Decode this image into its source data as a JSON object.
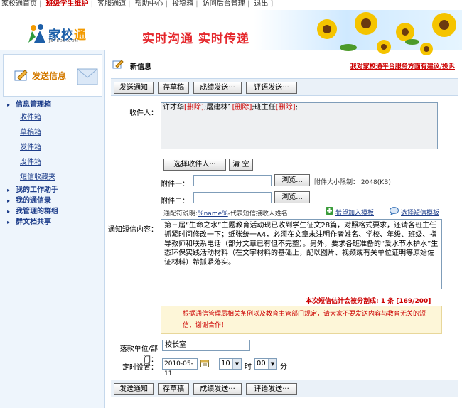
{
  "topnav": {
    "items": [
      "家校通首页",
      "班级学生维护",
      "客服通道",
      "帮助中心",
      "投稿箱",
      "访问后台管理",
      "退出"
    ],
    "active_index": 1
  },
  "banner": {
    "logo_name_a": "家校",
    "logo_name_b": "通",
    "logo_domain": "JSTEDU.COM",
    "slogan": "实时沟通 实时传递"
  },
  "sidebar": {
    "send_title": "发送信息",
    "groups": [
      {
        "label": "信息管理箱",
        "items": [
          "收件箱",
          "草稿箱",
          "发件箱",
          "废件箱",
          "短信收藏夹"
        ]
      },
      {
        "label": "我的工作助手",
        "items": []
      },
      {
        "label": "我的通信录",
        "items": []
      },
      {
        "label": "我管理的群组",
        "items": []
      },
      {
        "label": "群文档共享",
        "items": []
      }
    ]
  },
  "page": {
    "title": "新信息",
    "feedback_link": "我对家校通平台服务方面有建议/投诉"
  },
  "toolbar": {
    "send_notice": "发送通知",
    "save_draft": "存草稿",
    "send_grades": "成绩发送···",
    "send_comments": "评语发送···"
  },
  "form": {
    "recipient_label": "收件人：",
    "recipients": [
      {
        "name": "许才华",
        "action": "[删除]"
      },
      {
        "name": "屠建林1",
        "action": "[删除]"
      },
      {
        "name": "班主任",
        "action": "[删除]"
      }
    ],
    "select_recipient": "选择收件人···",
    "clear": "清 空",
    "attach1_label": "附件一：",
    "attach2_label": "附件二：",
    "browse": "浏览...",
    "attach_limit": "附件大小限制： 2048(KB)",
    "template_note_prefix": "通配符说明:",
    "template_var": "%name%",
    "template_note_suffix": "-代表短信接收人姓名",
    "add_template": "希望加入模板",
    "choose_template": "选择短信模板",
    "sms_label": "通知短信内容：",
    "sms_content": "第三届“生命之水”主题教育活动现已收到学生征文28篇，对照格式要求，还请各班主任抓紧时间修改一下；纸张统一A4，必须在文章末注明作者姓名、学校、年级、班级、指导教师和联系电话（部分文章已有但不完整）。另外，要求各班准备的“爱水节水护水”生态环保实践活动材料（在文字材料的基础上，配以图片、视频或有关单位证明等原始佐证材料）希抓紧落实。",
    "count_text": "本次短信估计会被分割成: 1 条 [169/200]",
    "warning": "根据通信管理局相关条例以及教育主管部门规定，请大家不要发送内容与教育无关的短信，谢谢合作！",
    "sender_label": "落款单位/部门：",
    "sender_value": "校长室",
    "schedule_label": "定时设置：",
    "date_value": "2010-05-11",
    "hour_value": "10",
    "hour_unit": "时",
    "minute_value": "00",
    "minute_unit": "分"
  },
  "colors": {
    "accent_red": "#c00000",
    "nav_blue": "#1d3d8a",
    "panel_bg": "#eaf1f8"
  }
}
